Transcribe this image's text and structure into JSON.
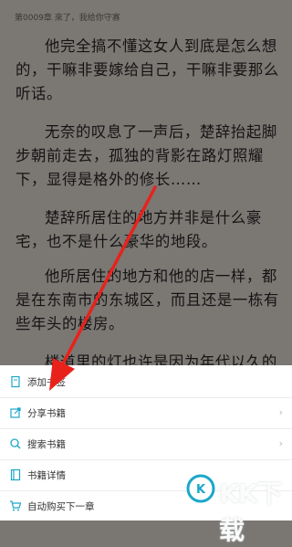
{
  "reader": {
    "chapter_header": "第0009章 來了，我给你守寡",
    "paragraphs": [
      "他完全搞不懂这女人到底是怎么想的，干嘛非要嫁给自己，干嘛非要那么听话。",
      "无奈的叹息了一声后，楚辞抬起脚步朝前走去，孤独的背影在路灯照耀下，显得是格外的修长……",
      "楚辞所居住的地方并非是什么豪宅，也不是什么豪华的地段。",
      "他所居住的地方和他的店一样，都是在东南市的东城区，而且还是一栋有些年头的楼房。",
      "楼道里的灯也许是因为年代以久的缘"
    ]
  },
  "menu": {
    "items": [
      {
        "label": "添加书签",
        "icon": "bookmark-icon",
        "chevron": ""
      },
      {
        "label": "分享书籍",
        "icon": "share-icon",
        "chevron": "›"
      },
      {
        "label": "搜索书籍",
        "icon": "search-icon",
        "chevron": "›"
      },
      {
        "label": "书籍详情",
        "icon": "book-details-icon",
        "chevron": ""
      },
      {
        "label": "自动购买下一章",
        "icon": "cart-icon",
        "chevron": ""
      }
    ]
  },
  "watermark": {
    "text": "KK下载",
    "url": "www.kkx.net"
  },
  "colors": {
    "accent": "#1ba7c9",
    "arrow": "#e8221b",
    "reader_bg": "#7b7773"
  }
}
